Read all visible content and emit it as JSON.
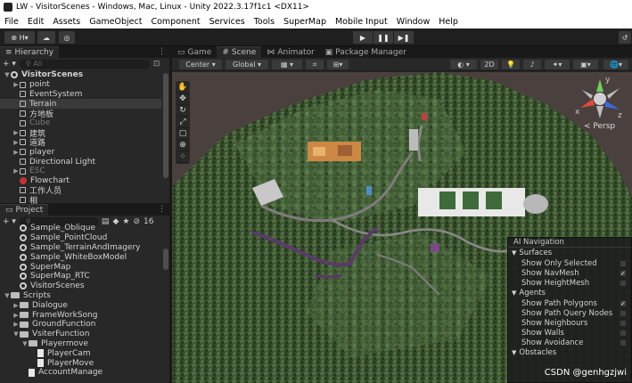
{
  "window": {
    "title": "LW - VisitorScenes - Windows, Mac, Linux - Unity 2022.3.17f1c1 <DX11>"
  },
  "menu": [
    "File",
    "Edit",
    "Assets",
    "GameObject",
    "Component",
    "Services",
    "Tools",
    "SuperMap",
    "Mobile Input",
    "Window",
    "Help"
  ],
  "toolbar": {
    "account": "H",
    "account_caret": "▾"
  },
  "hierarchy": {
    "tab": "Hierarchy",
    "search_placeholder": "All",
    "add": "+ ▾",
    "items": [
      {
        "label": "VisitorScenes",
        "indent": 0,
        "arrow": "▼",
        "icon": "unity",
        "root": true
      },
      {
        "label": "point",
        "indent": 1,
        "arrow": "▶",
        "icon": "cube"
      },
      {
        "label": "EventSystem",
        "indent": 1,
        "arrow": "",
        "icon": "cube"
      },
      {
        "label": "Terrain",
        "indent": 1,
        "arrow": "",
        "icon": "cube",
        "selected": true
      },
      {
        "label": "方地板",
        "indent": 1,
        "arrow": "",
        "icon": "cube"
      },
      {
        "label": "Cube",
        "indent": 1,
        "arrow": "",
        "icon": "cube",
        "dim": true
      },
      {
        "label": "建筑",
        "indent": 1,
        "arrow": "▶",
        "icon": "cube"
      },
      {
        "label": "道路",
        "indent": 1,
        "arrow": "▶",
        "icon": "cube"
      },
      {
        "label": "player",
        "indent": 1,
        "arrow": "▶",
        "icon": "cube"
      },
      {
        "label": "Directional Light",
        "indent": 1,
        "arrow": "",
        "icon": "cube"
      },
      {
        "label": "ESC",
        "indent": 1,
        "arrow": "▶",
        "icon": "cube",
        "dim": true
      },
      {
        "label": "Flowchart",
        "indent": 1,
        "arrow": "",
        "icon": "red"
      },
      {
        "label": "工作人员",
        "indent": 1,
        "arrow": "",
        "icon": "cube"
      },
      {
        "label": "相",
        "indent": 1,
        "arrow": "",
        "icon": "cube"
      }
    ]
  },
  "project": {
    "tab": "Project",
    "count": "16",
    "items": [
      {
        "label": "Sample_Oblique",
        "indent": 1,
        "arrow": "",
        "icon": "unity"
      },
      {
        "label": "Sample_PointCloud",
        "indent": 1,
        "arrow": "",
        "icon": "unity"
      },
      {
        "label": "Sample_TerrainAndImagery",
        "indent": 1,
        "arrow": "",
        "icon": "unity"
      },
      {
        "label": "Sample_WhiteBoxModel",
        "indent": 1,
        "arrow": "",
        "icon": "unity"
      },
      {
        "label": "SuperMap",
        "indent": 1,
        "arrow": "",
        "icon": "unity"
      },
      {
        "label": "SuperMap_RTC",
        "indent": 1,
        "arrow": "",
        "icon": "unity"
      },
      {
        "label": "VisitorScenes",
        "indent": 1,
        "arrow": "",
        "icon": "unity"
      },
      {
        "label": "Scripts",
        "indent": 0,
        "arrow": "▼",
        "icon": "folder"
      },
      {
        "label": "Dialogue",
        "indent": 1,
        "arrow": "▶",
        "icon": "folder"
      },
      {
        "label": "FrameWorkSong",
        "indent": 1,
        "arrow": "▶",
        "icon": "folder"
      },
      {
        "label": "GroundFunction",
        "indent": 1,
        "arrow": "▶",
        "icon": "folder"
      },
      {
        "label": "VsiterFunction",
        "indent": 1,
        "arrow": "▼",
        "icon": "folder"
      },
      {
        "label": "Playermove",
        "indent": 2,
        "arrow": "▼",
        "icon": "folder"
      },
      {
        "label": "PlayerCam",
        "indent": 3,
        "arrow": "",
        "icon": "script"
      },
      {
        "label": "PlayerMove",
        "indent": 3,
        "arrow": "",
        "icon": "script"
      },
      {
        "label": "AccountManage",
        "indent": 2,
        "arrow": "",
        "icon": "script"
      }
    ]
  },
  "scene_tabs": [
    {
      "label": "Game",
      "active": false
    },
    {
      "label": "Scene",
      "active": true
    },
    {
      "label": "Animator",
      "active": false
    },
    {
      "label": "Package Manager",
      "active": false
    }
  ],
  "scene_toolbar": {
    "pivot": "Center",
    "space": "Global",
    "mode2d": "2D"
  },
  "gizmo": {
    "x": "x",
    "y": "y",
    "z": "z",
    "persp": "< Persp"
  },
  "ai_navigation": {
    "title": "AI Navigation",
    "sections": [
      {
        "title": "Surfaces",
        "rows": [
          {
            "label": "Show Only Selected",
            "checked": false
          },
          {
            "label": "Show NavMesh",
            "checked": true
          },
          {
            "label": "Show HeightMesh",
            "checked": false
          }
        ]
      },
      {
        "title": "Agents",
        "rows": [
          {
            "label": "Show Path Polygons",
            "checked": true
          },
          {
            "label": "Show Path Query Nodes",
            "checked": false
          },
          {
            "label": "Show Neighbours",
            "checked": false
          },
          {
            "label": "Show Walls",
            "checked": false
          },
          {
            "label": "Show Avoidance",
            "checked": false
          }
        ]
      },
      {
        "title": "Obstacles",
        "rows": []
      }
    ]
  },
  "watermark": "CSDN @genhgzjwi",
  "colors": {
    "terrain_dark": "#2d3d22",
    "terrain_mid": "#4d6b3a",
    "road": "#7e7c7a",
    "path_polygons": "#5a3a6a",
    "navmesh": "#4a90c8"
  }
}
